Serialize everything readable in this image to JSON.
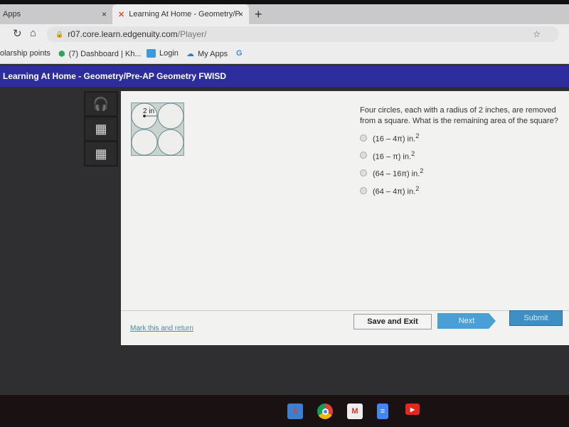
{
  "browser": {
    "tabs": [
      {
        "label": "Apps",
        "close": "×"
      },
      {
        "label": "Learning At Home - Geometry/P",
        "close": "×",
        "active": true
      }
    ],
    "new_tab": "+",
    "url_host": "r07.core.learn.edgenuity.com",
    "url_path": "/Player/",
    "bookmarks": [
      "olarship points",
      "(7) Dashboard | Kh...",
      "Login",
      "My Apps",
      "G"
    ]
  },
  "header": {
    "title": "Learning At Home - Geometry/Pre-AP Geometry FWISD",
    "color": "#2d2d9e"
  },
  "tools": [
    "headphones-icon",
    "calculator-icon",
    "calculator-icon"
  ],
  "diagram": {
    "radius_label": "2 in"
  },
  "question": {
    "text": "Four circles, each with a radius of 2 inches, are removed from a square. What is the remaining area of the square?",
    "options": [
      {
        "label": "(16 – 4π) in.",
        "sup": "2"
      },
      {
        "label": "(16 – π) in.",
        "sup": "2"
      },
      {
        "label": "(64 – 16π) in.",
        "sup": "2"
      },
      {
        "label": "(64 – 4π) in.",
        "sup": "2"
      }
    ]
  },
  "footer": {
    "mark": "Mark this and return",
    "save": "Save and Exit",
    "next": "Next",
    "submit": "Submit"
  }
}
